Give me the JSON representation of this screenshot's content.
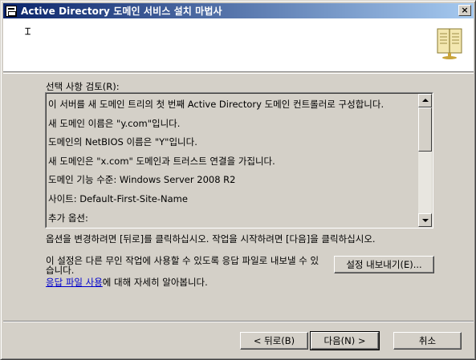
{
  "window": {
    "title": "Active Directory 도메인 서비스 설치 마법사",
    "close_label": "×"
  },
  "header": {
    "cursor_glyph": "⌶",
    "icon": "book-icon"
  },
  "review": {
    "label": "선택 사항 검토(R):",
    "lines": [
      "이 서버를 새 도메인 트리의 첫 번째 Active Directory 도메인 컨트롤러로 구성합니다.",
      "새 도메인 이름은 \"y.com\"입니다.",
      "도메인의 NetBIOS 이름은 \"Y\"입니다.",
      "새 도메인은 \"x.com\" 도메인과 트러스트 연결을 가집니다.",
      "도메인 기능 수준: Windows Server 2008 R2",
      "사이트: Default-First-Site-Name",
      "추가 옵션:"
    ]
  },
  "instruction": "옵션을 변경하려면 [뒤로]를 클릭하십시오. 작업을 시작하려면 [다음]을 클릭하십시오.",
  "export": {
    "description": "이 설정은 다른 무인 작업에 사용할 수 있도록 응답 파일로 내보낼 수 있습니다.",
    "button_label": "설정 내보내기(E)..."
  },
  "help": {
    "link_text": "응답 파일 사용",
    "suffix": "에 대해 자세히 알아봅니다."
  },
  "buttons": {
    "back": "< 뒤로(B)",
    "next": "다음(N) >",
    "cancel": "취소"
  }
}
